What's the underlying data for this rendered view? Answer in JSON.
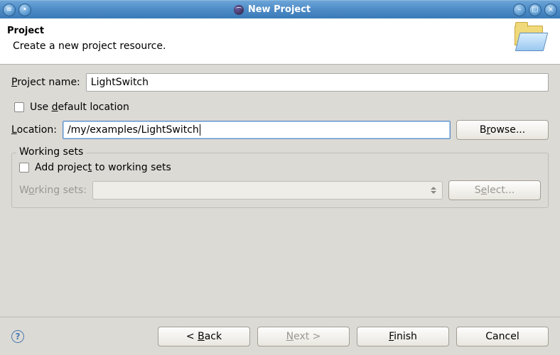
{
  "window": {
    "title": "New Project"
  },
  "header": {
    "title": "Project",
    "description": "Create a new project resource."
  },
  "form": {
    "project_name_label_pre": "P",
    "project_name_label_post": "roject name:",
    "project_name_value": "LightSwitch",
    "use_default_pre": "Use ",
    "use_default_mnemonic": "d",
    "use_default_post": "efault location",
    "location_label_pre": "L",
    "location_label_post": "ocation:",
    "location_value": "/my/examples/LightSwitch",
    "browse_pre": "B",
    "browse_mnemonic": "r",
    "browse_post": "owse..."
  },
  "working_sets": {
    "group_title": "Working sets",
    "add_pre": "Add projec",
    "add_mnemonic": "t",
    "add_post": " to working sets",
    "combo_label_pre": "W",
    "combo_label_mnemonic": "o",
    "combo_label_post": "rking sets:",
    "select_pre": "S",
    "select_mnemonic": "e",
    "select_post": "lect..."
  },
  "buttons": {
    "back_pre": "< ",
    "back_mnemonic": "B",
    "back_post": "ack",
    "next_pre": "",
    "next_mnemonic": "N",
    "next_post": "ext >",
    "finish_pre": "",
    "finish_mnemonic": "F",
    "finish_post": "inish",
    "cancel": "Cancel"
  }
}
